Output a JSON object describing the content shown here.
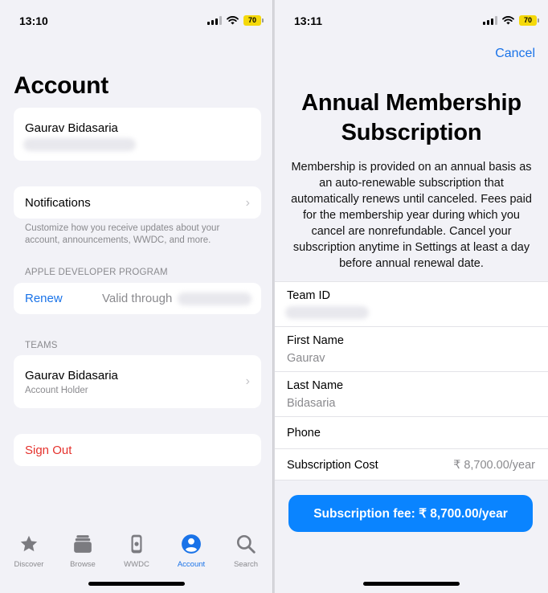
{
  "left": {
    "status": {
      "time": "13:10",
      "battery": "70"
    },
    "title": "Account",
    "profile": {
      "name": "Gaurav Bidasaria"
    },
    "notifications": {
      "label": "Notifications",
      "footnote": "Customize how you receive updates about your account, announcements, WWDC, and more."
    },
    "program": {
      "header": "APPLE DEVELOPER PROGRAM",
      "renew": "Renew",
      "valid": "Valid through"
    },
    "teams": {
      "header": "TEAMS",
      "name": "Gaurav Bidasaria",
      "role": "Account Holder"
    },
    "sign_out": "Sign Out",
    "tabbar": {
      "active": "Account",
      "tabs": [
        {
          "label": "Discover",
          "icon": "star-icon"
        },
        {
          "label": "Browse",
          "icon": "stack-icon"
        },
        {
          "label": "WWDC",
          "icon": "wwdc-icon"
        },
        {
          "label": "Account",
          "icon": "person-circle-icon"
        },
        {
          "label": "Search",
          "icon": "search-icon"
        }
      ]
    }
  },
  "right": {
    "status": {
      "time": "13:11",
      "battery": "70"
    },
    "cancel": "Cancel",
    "title_line1": "Annual Membership",
    "title_line2": "Subscription",
    "description": "Membership is provided on an annual basis as an auto-renewable subscription that automatically renews until canceled. Fees paid for the membership year during which you cancel are nonrefundable. Cancel your subscription anytime in Settings at least a day before annual renewal date.",
    "fields": {
      "team_id": {
        "label": "Team ID"
      },
      "first_name": {
        "label": "First Name",
        "value": "Gaurav"
      },
      "last_name": {
        "label": "Last Name",
        "value": "Bidasaria"
      },
      "phone": {
        "label": "Phone"
      },
      "cost": {
        "label": "Subscription Cost",
        "value": "₹ 8,700.00/year"
      }
    },
    "pay_button": "Subscription fee: ₹ 8,700.00/year"
  },
  "colors": {
    "accent": "#0a84ff",
    "link": "#1a73e8",
    "destructive": "#e5322d"
  }
}
